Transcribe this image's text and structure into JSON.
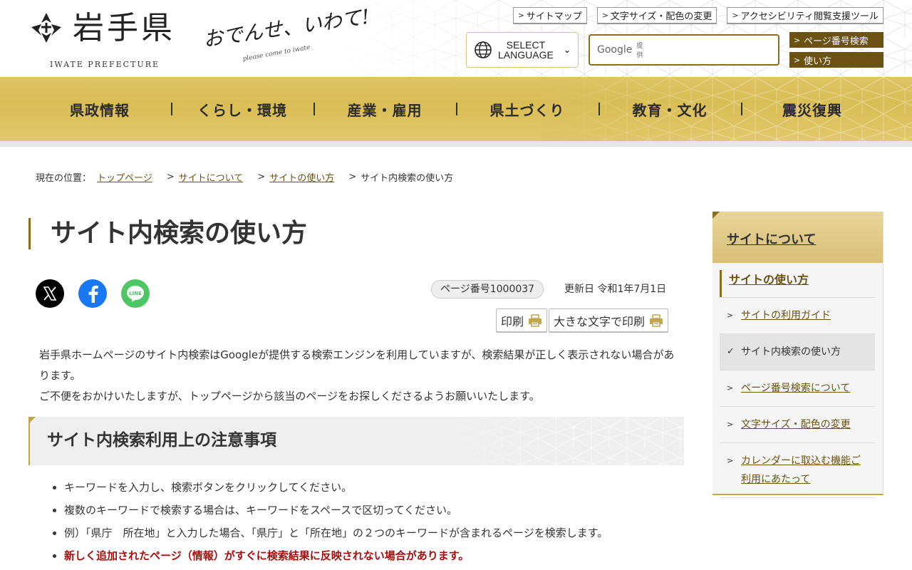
{
  "header": {
    "logo_text": "岩手県",
    "logo_sub": "IWATE PREFECTURE",
    "tagline": "おでんせ、いわて!",
    "tagline_sub": "please come to iwate",
    "util_links": [
      "サイトマップ",
      "文字サイズ・配色の変更",
      "アクセシビリティ閲覧支援ツール"
    ],
    "language_label_1": "SELECT",
    "language_label_2": "LANGUAGE",
    "search": {
      "google_label": "Google",
      "google_sub": "提供",
      "placeholder": ""
    },
    "side_buttons": [
      "ページ番号検索",
      "使い方"
    ]
  },
  "nav": {
    "items": [
      "県政情報",
      "くらし・環境",
      "産業・雇用",
      "県土づくり",
      "教育・文化",
      "震災復興"
    ]
  },
  "breadcrumb": {
    "prefix": "現在の位置：",
    "links": [
      "トップページ",
      "サイトについて",
      "サイトの使い方"
    ],
    "current": "サイト内検索の使い方",
    "separator": ">"
  },
  "page": {
    "title": "サイト内検索の使い方",
    "page_number": "ページ番号1000037",
    "updated": "更新日 令和1年7月1日",
    "print": "印刷",
    "print_large": "大きな文字で印刷",
    "intro_1": "岩手県ホームページのサイト内検索はGoogleが提供する検索エンジンを利用していますが、検索結果が正しく表示されない場合があります。",
    "intro_2": "ご不便をおかけいたしますが、トップページから該当のページをお探しくださるようお願いいたします。",
    "section_title": "サイト内検索利用上の注意事項",
    "notes": [
      "キーワードを入力し、検索ボタンをクリックしてください。",
      "複数のキーワードで検索する場合は、キーワードをスペースで区切ってください。",
      "例）「県庁　所在地」と入力した場合、「県庁」と「所在地」の２つのキーワードが含まれるページを検索します。",
      "新しく追加されたページ（情報）がすぐに検索結果に反映されない場合があります。"
    ]
  },
  "sidebar": {
    "heading": "サイトについて",
    "sub_heading": "サイトの使い方",
    "items": [
      "サイトの利用ガイド",
      "サイト内検索の使い方",
      "ページ番号検索について",
      "文字サイズ・配色の変更",
      "カレンダーに取込む機能ご利用にあたって"
    ]
  },
  "colors": {
    "gold": "#dcc162",
    "dark_gold": "#6b5213",
    "warning": "#a50e0e"
  }
}
